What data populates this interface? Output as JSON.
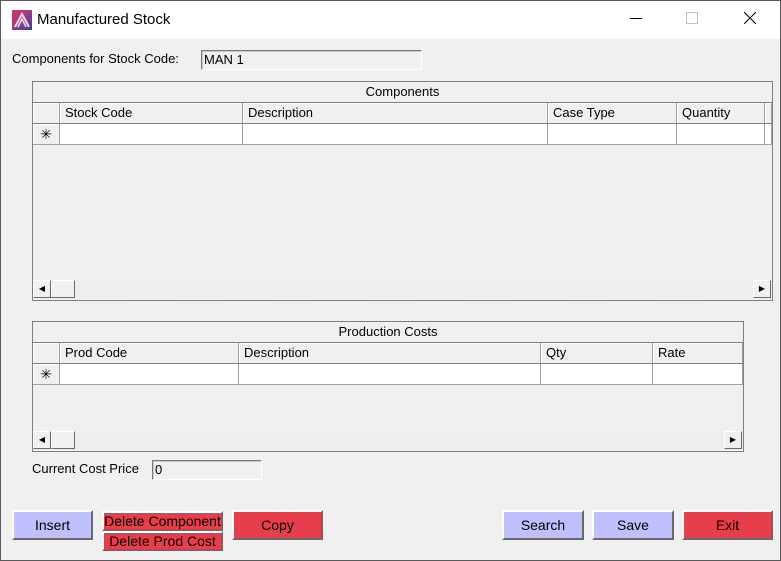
{
  "window": {
    "title": "Manufactured Stock",
    "icon": "app-logo-icon",
    "controls": {
      "minimize": "minimize-icon",
      "maximize": "maximize-icon",
      "close": "close-icon"
    }
  },
  "stock_code": {
    "label": "Components for Stock Code:",
    "value": "MAN 1"
  },
  "components_grid": {
    "caption": "Components",
    "columns": [
      "Stock Code",
      "Description",
      "Case Type",
      "Quantity",
      ""
    ],
    "new_row_marker": "✳",
    "rows": []
  },
  "production_grid": {
    "caption": "Production Costs",
    "columns": [
      "Prod Code",
      "Description",
      "Qty",
      "Rate"
    ],
    "new_row_marker": "✳",
    "rows": []
  },
  "cost_price": {
    "label": "Current Cost Price",
    "value": "0"
  },
  "buttons": {
    "insert": "Insert",
    "delete_component": "Delete Component",
    "delete_prod_cost": "Delete Prod Cost",
    "copy": "Copy",
    "search": "Search",
    "save": "Save",
    "exit": "Exit"
  },
  "colors": {
    "action_blue": "#c0c0ff",
    "action_red": "#e63e4a"
  }
}
